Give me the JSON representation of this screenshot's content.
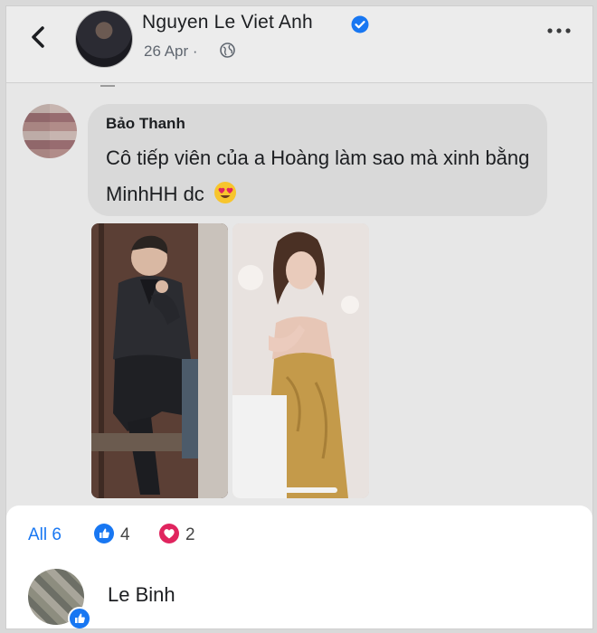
{
  "header": {
    "author": "Nguyen Le Viet Anh",
    "date": "26 Apr",
    "separator": "·",
    "icons": [
      "back-arrow-icon",
      "verified-badge-icon",
      "globe-icon",
      "more-options-icon"
    ]
  },
  "comment": {
    "name": "Bảo Thanh",
    "text": "Cô tiếp viên của a Hoàng làm sao mà xinh bằng MinhHH dc",
    "emoji": "😍"
  },
  "reactions": {
    "all_label": "All 6",
    "like_count": "4",
    "love_count": "2",
    "like_color": "#1877f2",
    "love_color": "#e0245e"
  },
  "reactor": {
    "name": "Le Binh"
  }
}
